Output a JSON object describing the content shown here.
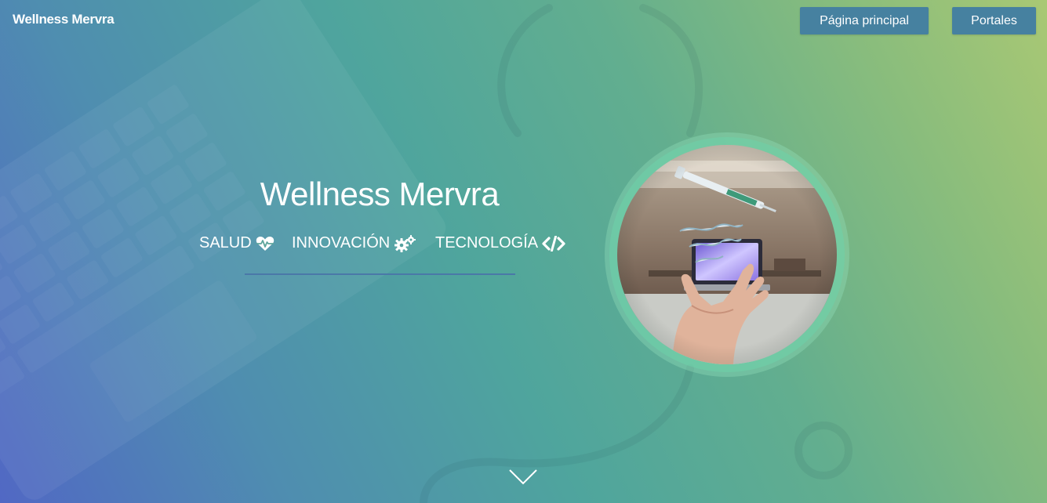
{
  "navbar": {
    "brand": "Wellness Mervra",
    "buttons": [
      {
        "label": "Página principal"
      },
      {
        "label": "Portales"
      }
    ]
  },
  "hero": {
    "title": "Wellness Mervra",
    "tags": [
      {
        "label": "SALUD",
        "icon": "heartbeat-icon"
      },
      {
        "label": "INNOVACIÓN",
        "icon": "gears-icon"
      },
      {
        "label": "TECNOLOGÍA",
        "icon": "code-icon"
      }
    ],
    "image": {
      "subject": "hand-with-floating-syringe-and-dna"
    },
    "scroll_icon": "chevron-down-icon"
  },
  "colors": {
    "gradient_start": "#5168c4",
    "gradient_mid": "#4fa59d",
    "gradient_end": "#a9c874",
    "nav_button": "#4681a0",
    "divider": "#4a78a8"
  }
}
